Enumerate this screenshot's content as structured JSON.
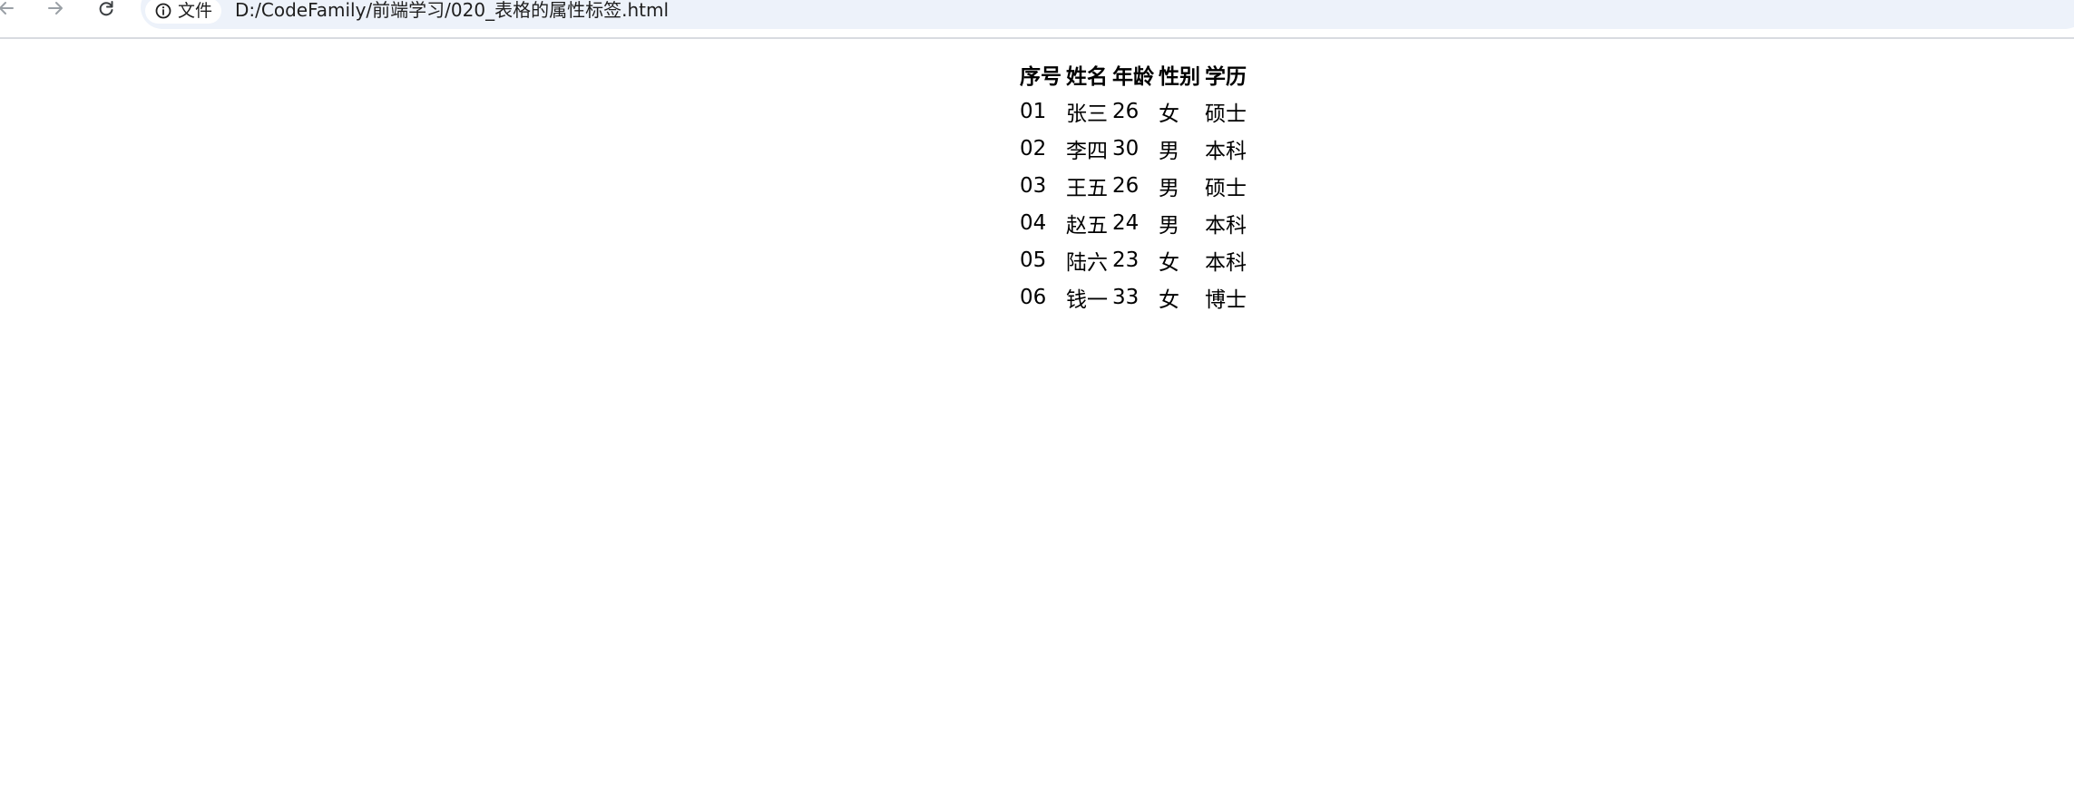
{
  "browser": {
    "nav": {
      "back_icon": "arrow-left-icon",
      "forward_icon": "arrow-right-icon",
      "reload_icon": "reload-icon"
    },
    "site_chip": {
      "icon": "info-icon",
      "label": "文件"
    },
    "url": "D:/CodeFamily/前端学习/020_表格的属性标签.html"
  },
  "table": {
    "headers": [
      "序号",
      "姓名",
      "年龄",
      "性别",
      "学历"
    ],
    "rows": [
      [
        "01",
        "张三",
        "26",
        "女",
        "硕士"
      ],
      [
        "02",
        "李四",
        "30",
        "男",
        "本科"
      ],
      [
        "03",
        "王五",
        "26",
        "男",
        "硕士"
      ],
      [
        "04",
        "赵五",
        "24",
        "男",
        "本科"
      ],
      [
        "05",
        "陆六",
        "23",
        "女",
        "本科"
      ],
      [
        "06",
        "钱一",
        "33",
        "女",
        "博士"
      ]
    ]
  }
}
